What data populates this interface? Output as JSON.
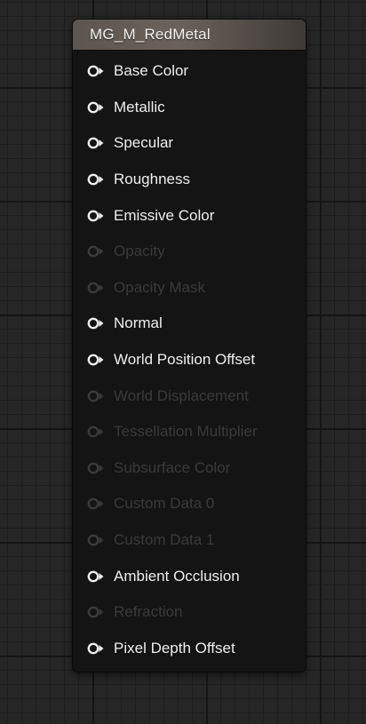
{
  "node": {
    "title": "MG_M_RedMetal",
    "pins": [
      {
        "label": "Base Color",
        "enabled": true
      },
      {
        "label": "Metallic",
        "enabled": true
      },
      {
        "label": "Specular",
        "enabled": true
      },
      {
        "label": "Roughness",
        "enabled": true
      },
      {
        "label": "Emissive Color",
        "enabled": true
      },
      {
        "label": "Opacity",
        "enabled": false
      },
      {
        "label": "Opacity Mask",
        "enabled": false
      },
      {
        "label": "Normal",
        "enabled": true
      },
      {
        "label": "World Position Offset",
        "enabled": true
      },
      {
        "label": "World Displacement",
        "enabled": false
      },
      {
        "label": "Tessellation Multiplier",
        "enabled": false
      },
      {
        "label": "Subsurface Color",
        "enabled": false
      },
      {
        "label": "Custom Data 0",
        "enabled": false
      },
      {
        "label": "Custom Data 1",
        "enabled": false
      },
      {
        "label": "Ambient Occlusion",
        "enabled": true
      },
      {
        "label": "Refraction",
        "enabled": false
      },
      {
        "label": "Pixel Depth Offset",
        "enabled": true
      }
    ]
  },
  "colors": {
    "pin_enabled": "#eeeeee",
    "pin_disabled": "#3a3a3a",
    "header_accent": "#6b625b",
    "node_body": "#141414",
    "graph_background": "#262626"
  },
  "icons": {
    "pin": "pin-connector-icon"
  }
}
